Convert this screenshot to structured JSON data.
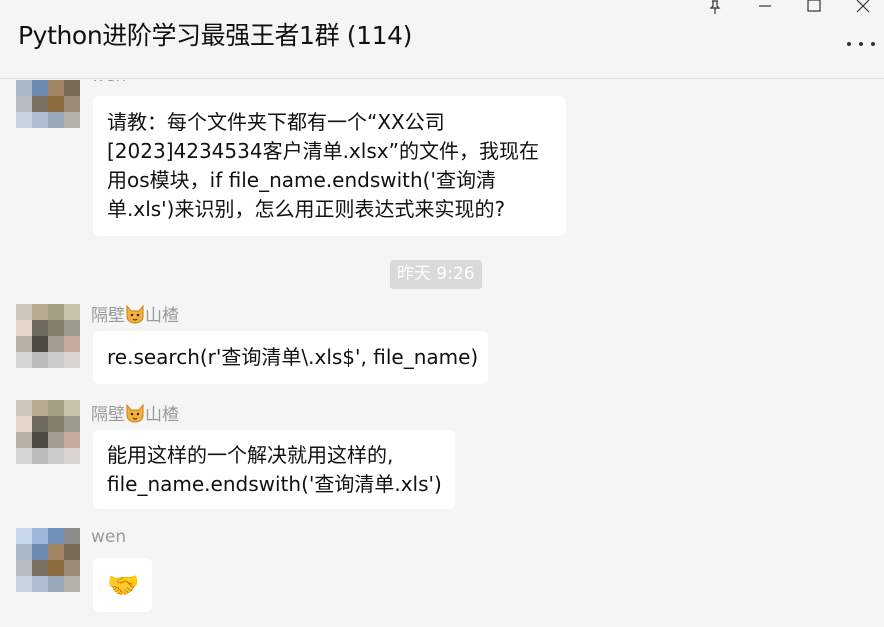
{
  "window": {
    "title": "Python进阶学习最强王者1群 (114)"
  },
  "messages": [
    {
      "sender": "wen",
      "lines": [
        "请教：每个文件夹下都有一个“XX公司",
        "[2023]4234534客户清单.xlsx”的文件，我现在",
        "用os模块，if file_name.endswith('查询清",
        "单.xls')来识别，怎么用正则表达式来实现的?"
      ]
    },
    {
      "timestamp": "昨天 9:26"
    },
    {
      "sender_prefix": "隔壁",
      "sender_suffix": "山楂",
      "lines": [
        "re.search(r'查询清单\\.xls$', file_name)"
      ]
    },
    {
      "sender_prefix": "隔壁",
      "sender_suffix": "山楂",
      "lines": [
        "能用这样的一个解决就用这样的,",
        "file_name.endswith('查询清单.xls')"
      ]
    },
    {
      "sender": "wen",
      "emoji": "🤝"
    }
  ],
  "colors": {
    "background": "#f5f5f5",
    "bubble": "#ffffff",
    "sender_name": "#9a9a9a",
    "timestamp_bg": "#d9d9d9",
    "avatar_wen": [
      "#c6d7ee",
      "#9bb7dc",
      "#6f8fb6",
      "#8a8a8a",
      "#a9b9c9",
      "#6d8bb0",
      "#a08463",
      "#7a6a58",
      "#b7bcc2",
      "#7d7060",
      "#8b6a3e",
      "#9c8b74",
      "#c8d3df",
      "#aebfd3",
      "#9aa9ba",
      "#b5b2aa"
    ],
    "avatar_shanzha": [
      "#cfc6bd",
      "#b5ab8f",
      "#a3a083",
      "#c8c2ac",
      "#e3d7c9",
      "#6e6b5d",
      "#84806d",
      "#9c9c8c",
      "#b8b2a6",
      "#4b4a43",
      "#a49b92",
      "#c7aaa0",
      "#d5d5d5",
      "#bcbcbc",
      "#cbcbcb",
      "#dad5d0"
    ]
  },
  "icons": [
    "pin-icon",
    "minimize-icon",
    "maximize-icon",
    "close-icon",
    "more-icon",
    "cat-emoji",
    "handshake-emoji"
  ]
}
